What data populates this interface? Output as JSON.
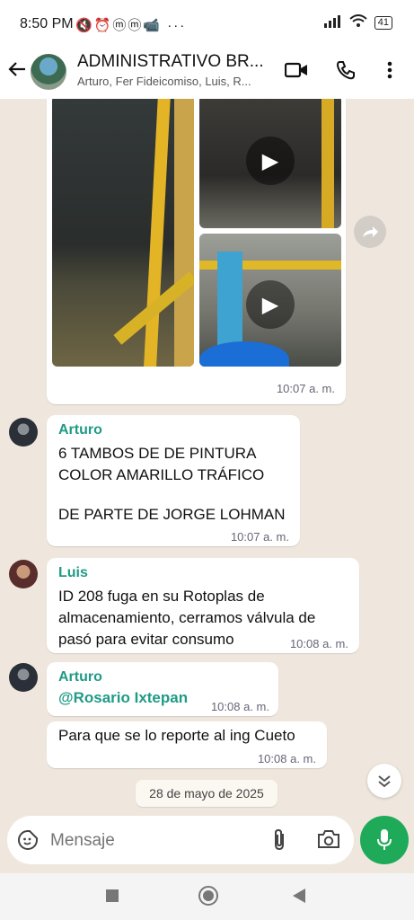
{
  "status_bar": {
    "time": "8:50 PM",
    "battery": "41"
  },
  "header": {
    "title": "ADMINISTRATIVO BR...",
    "subtitle": "Arturo, Fer Fideicomiso, Luis, R..."
  },
  "messages": {
    "media": {
      "time": "10:07 a. m."
    },
    "m1": {
      "sender": "Arturo",
      "line1": "6 TAMBOS DE DE PINTURA",
      "line2": "COLOR AMARILLO TRÁFICO",
      "line3": "DE PARTE DE JORGE LOHMAN",
      "time": "10:07 a. m."
    },
    "m2": {
      "sender": "Luis",
      "line1": "ID 208 fuga en su Rotoplas de",
      "line2": "almacenamiento, cerramos válvula de",
      "line3": "pasó para evitar consumo",
      "time": "10:08 a. m."
    },
    "m3": {
      "sender": "Arturo",
      "mention": "@Rosario Ixtepan",
      "time": "10:08 a. m."
    },
    "m4": {
      "text": "Para que se lo reporte al ing Cueto",
      "time": "10:08 a. m."
    }
  },
  "date_chip": "28 de mayo de 2025",
  "composer": {
    "placeholder": "Mensaje"
  },
  "colors": {
    "accent": "#1f9b86",
    "mic": "#1faa59",
    "chat_bg": "#efe7dd"
  }
}
